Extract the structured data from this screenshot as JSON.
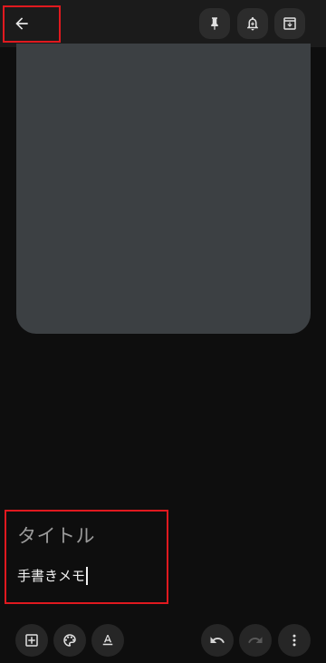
{
  "toolbar": {
    "back": "back-arrow-icon",
    "pin": "pin-icon",
    "reminder": "bell-plus-icon",
    "archive": "archive-icon"
  },
  "note": {
    "title_placeholder": "タイトル",
    "body": "手書きメモ"
  },
  "bottom_toolbar": {
    "add": "add-box-icon",
    "palette": "palette-icon",
    "text_format": "text-format-icon",
    "undo": "undo-icon",
    "redo": "redo-icon",
    "more": "more-vert-icon"
  },
  "colors": {
    "background": "#0e0e0e",
    "topbar": "#1b1b1b",
    "button_bg": "#2c2c2c",
    "drawing_card": "#3c4043",
    "highlight": "#e0191f",
    "placeholder_text": "#9a9a9a"
  }
}
